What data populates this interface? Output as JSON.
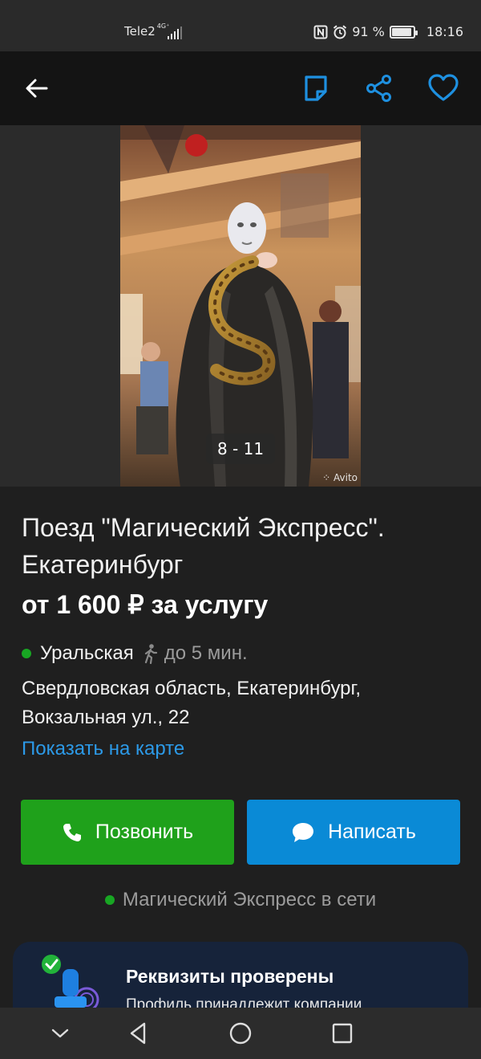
{
  "status_bar": {
    "carrier": "Tele2",
    "network": "4G⁺",
    "battery": "91 %",
    "battery_level": 0.91,
    "time": "18:16"
  },
  "top_bar": {
    "icons": [
      "back-arrow-icon",
      "note-icon",
      "share-icon",
      "heart-icon"
    ]
  },
  "gallery": {
    "counter": "8 - 11",
    "watermark": "Avito"
  },
  "listing": {
    "title": "Поезд \"Магический Экспресс\". Екатеринбург",
    "price": "от 1 600 ₽ за услугу",
    "metro_station": "Уральская",
    "metro_time": "до 5 мин.",
    "address": "Свердловская область, Екатеринбург, Вокзальная ул., 22",
    "map_link": "Показать на карте"
  },
  "actions": {
    "call_label": "Позвонить",
    "message_label": "Написать"
  },
  "seller": {
    "online_text": "Магический Экспресс в сети"
  },
  "verified": {
    "title": "Реквизиты проверены",
    "subtitle": "Профиль принадлежит компании"
  },
  "colors": {
    "green": "#1fa11b",
    "blue": "#0a8ad6",
    "link": "#2c9ae8",
    "icon_accent": "#1e90e0"
  }
}
